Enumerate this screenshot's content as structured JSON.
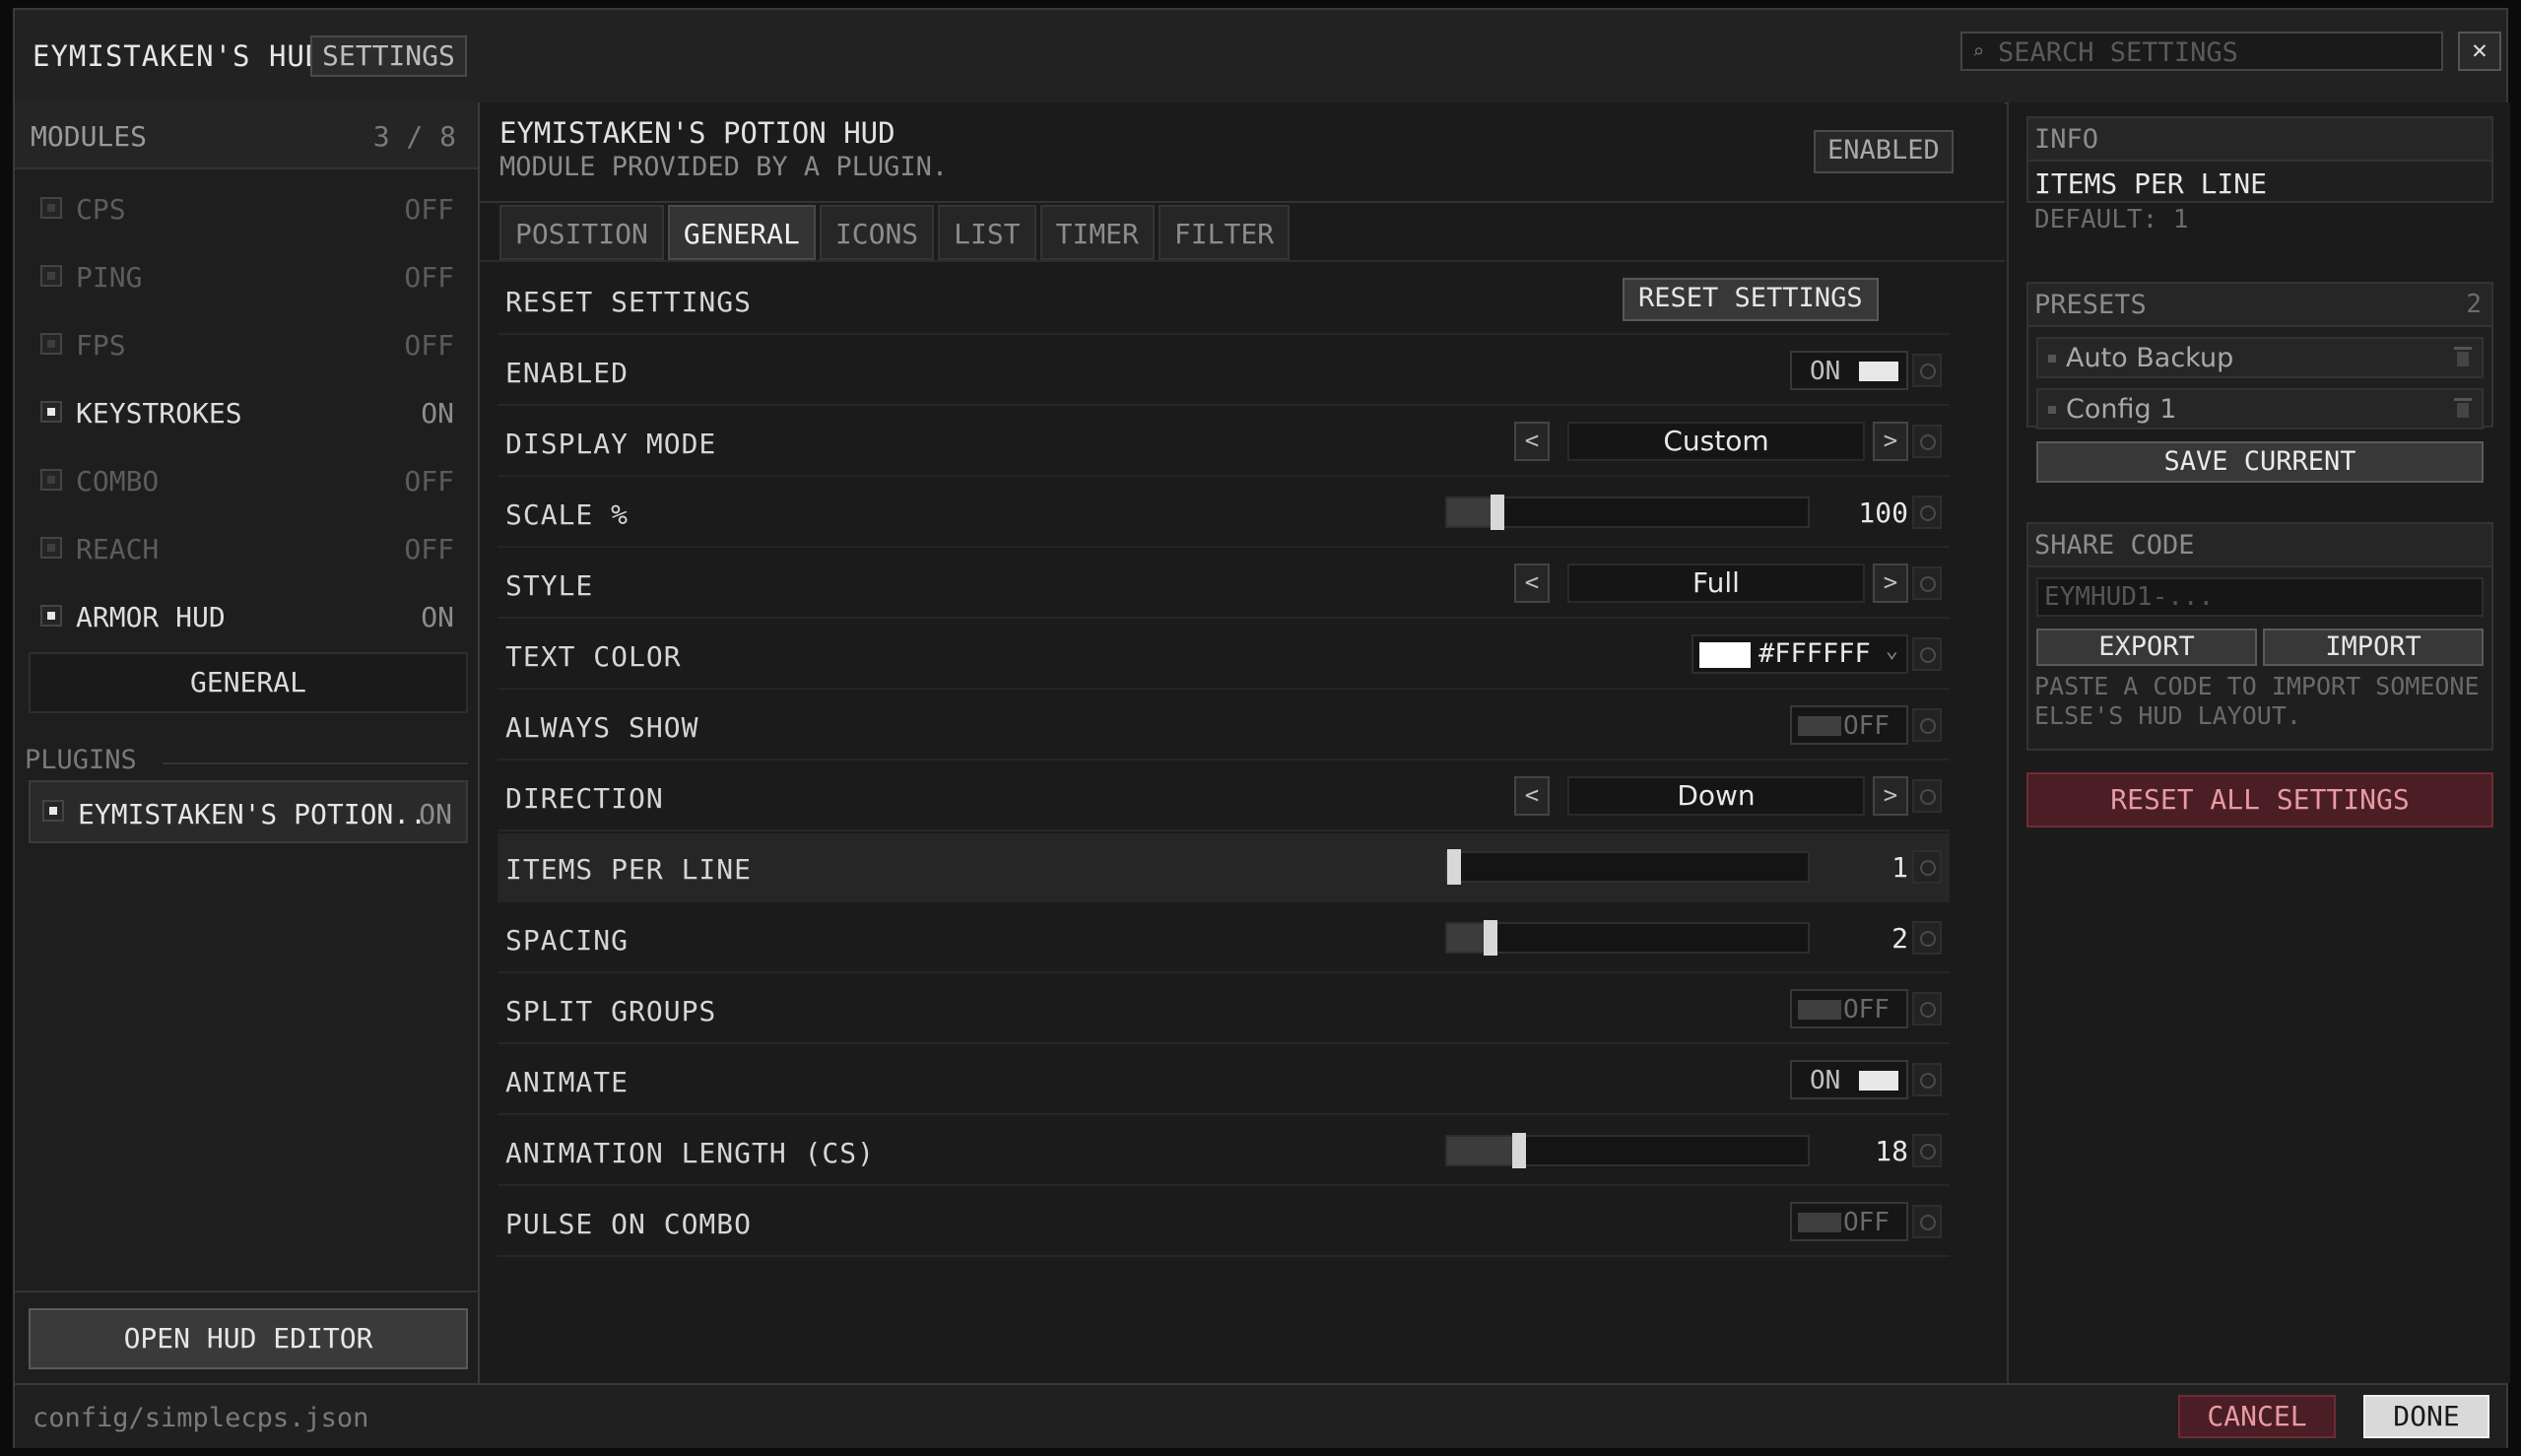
{
  "header": {
    "title": "EYMISTAKEN'S HUD",
    "settings_chip": "SETTINGS",
    "search_placeholder": "SEARCH SETTINGS",
    "close_glyph": "✕"
  },
  "sidebar": {
    "modules_label": "MODULES",
    "modules_count": "3 / 8",
    "modules": [
      {
        "name": "CPS",
        "state": "OFF",
        "enabled": false
      },
      {
        "name": "PING",
        "state": "OFF",
        "enabled": false
      },
      {
        "name": "FPS",
        "state": "OFF",
        "enabled": false
      },
      {
        "name": "KEYSTROKES",
        "state": "ON",
        "enabled": true
      },
      {
        "name": "COMBO",
        "state": "OFF",
        "enabled": false
      },
      {
        "name": "REACH",
        "state": "OFF",
        "enabled": false
      },
      {
        "name": "ARMOR HUD",
        "state": "ON",
        "enabled": true
      }
    ],
    "general_button": "GENERAL",
    "plugins_label": "PLUGINS",
    "plugin": {
      "name": "EYMISTAKEN'S POTION..",
      "state": "ON"
    },
    "open_editor_button": "OPEN HUD EDITOR"
  },
  "module": {
    "title": "EYMISTAKEN'S POTION HUD",
    "subtitle": "MODULE PROVIDED BY A PLUGIN.",
    "status_badge": "ENABLED"
  },
  "tabs": [
    {
      "label": "POSITION",
      "active": false
    },
    {
      "label": "GENERAL",
      "active": true
    },
    {
      "label": "ICONS",
      "active": false
    },
    {
      "label": "LIST",
      "active": false
    },
    {
      "label": "TIMER",
      "active": false
    },
    {
      "label": "FILTER",
      "active": false
    }
  ],
  "settings": [
    {
      "label": "RESET SETTINGS",
      "type": "button",
      "value": "RESET SETTINGS"
    },
    {
      "label": "ENABLED",
      "type": "toggle",
      "value": "ON",
      "on": true
    },
    {
      "label": "DISPLAY MODE",
      "type": "cycle",
      "value": "Custom"
    },
    {
      "label": "SCALE %",
      "type": "slider",
      "value": "100",
      "fraction": 0.12
    },
    {
      "label": "STYLE",
      "type": "cycle",
      "value": "Full"
    },
    {
      "label": "TEXT COLOR",
      "type": "color",
      "value": "#FFFFFF",
      "swatch": "#ffffff"
    },
    {
      "label": "ALWAYS SHOW",
      "type": "toggle",
      "value": "OFF",
      "on": false
    },
    {
      "label": "DIRECTION",
      "type": "cycle",
      "value": "Down"
    },
    {
      "label": "ITEMS PER LINE",
      "type": "slider",
      "value": "1",
      "fraction": 0.0,
      "highlight": true
    },
    {
      "label": "SPACING",
      "type": "slider",
      "value": "2",
      "fraction": 0.1
    },
    {
      "label": "SPLIT GROUPS",
      "type": "toggle",
      "value": "OFF",
      "on": false
    },
    {
      "label": "ANIMATE",
      "type": "toggle",
      "value": "ON",
      "on": true
    },
    {
      "label": "ANIMATION LENGTH (CS)",
      "type": "slider",
      "value": "18",
      "fraction": 0.18
    },
    {
      "label": "PULSE ON COMBO",
      "type": "toggle",
      "value": "OFF",
      "on": false
    }
  ],
  "info": {
    "label": "INFO",
    "name": "ITEMS PER LINE",
    "default": "DEFAULT: 1"
  },
  "presets": {
    "label": "PRESETS",
    "count": "2",
    "items": [
      "Auto Backup",
      "Config 1"
    ],
    "save_button": "SAVE CURRENT"
  },
  "share": {
    "label": "SHARE CODE",
    "placeholder": "EYMHUD1-...",
    "export_button": "EXPORT",
    "import_button": "IMPORT",
    "help": "PASTE A CODE TO IMPORT SOMEONE ELSE'S HUD LAYOUT."
  },
  "reset_all_button": "RESET ALL SETTINGS",
  "footer": {
    "path": "config/simplecps.json",
    "cancel_button": "CANCEL",
    "done_button": "DONE"
  }
}
